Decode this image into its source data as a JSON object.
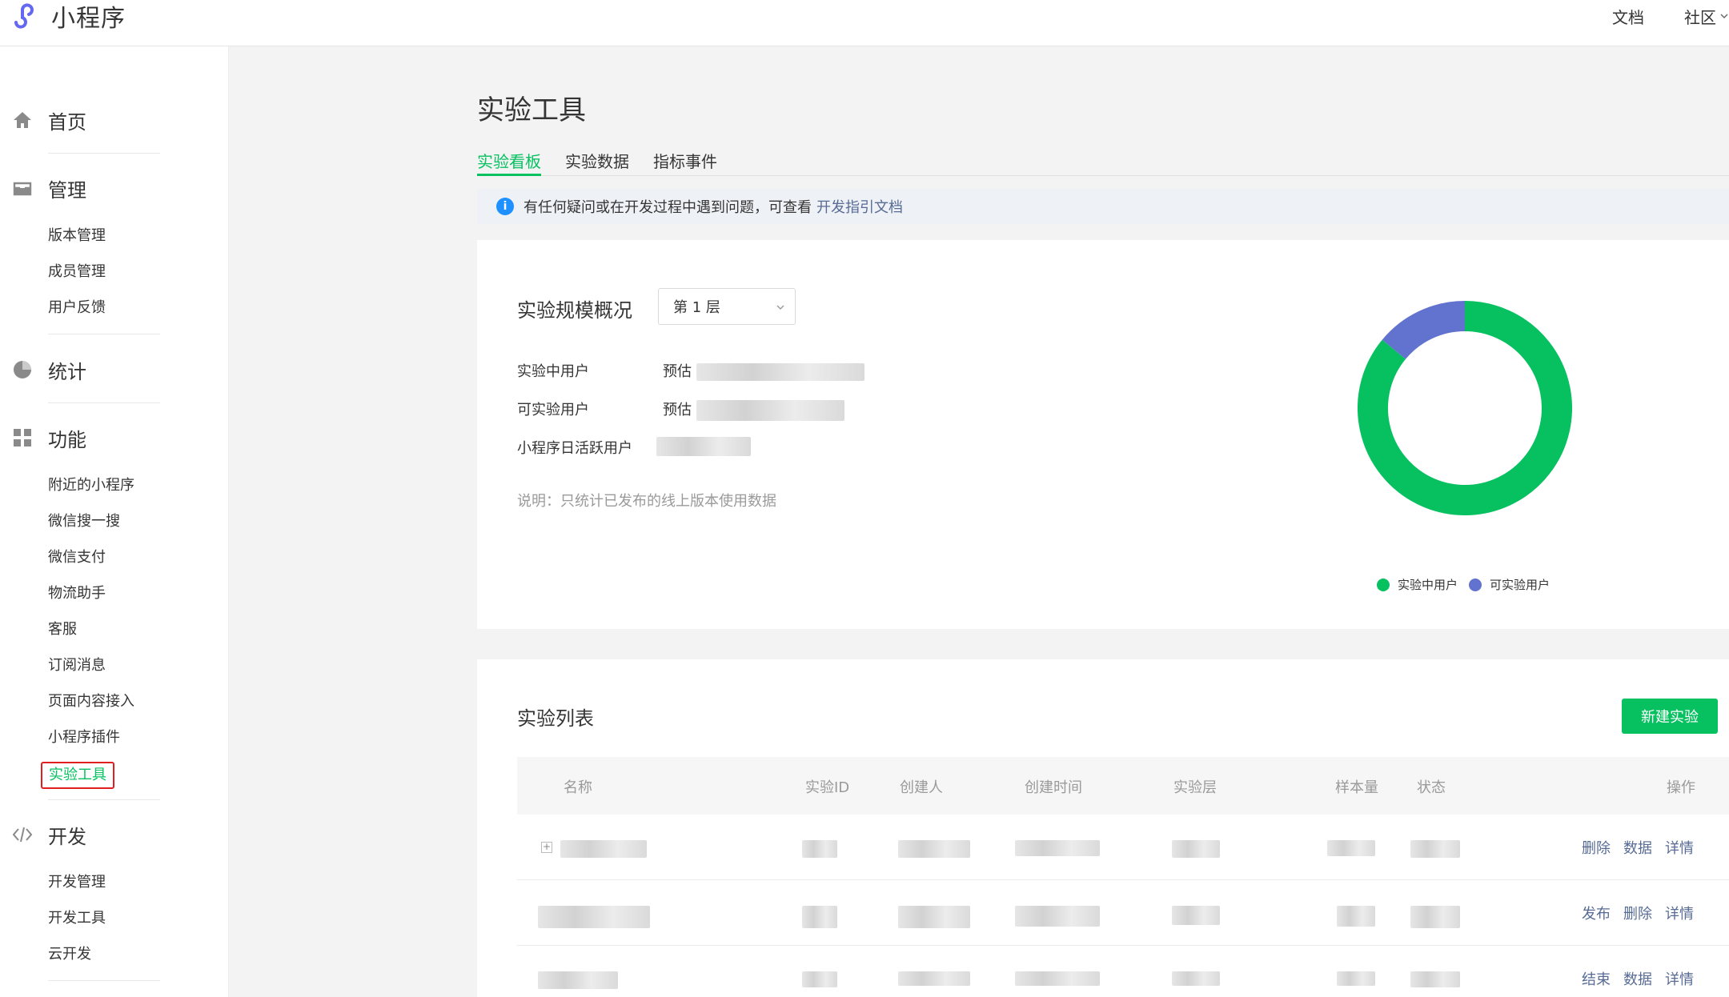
{
  "header": {
    "app_name": "小程序",
    "links": [
      {
        "label": "文档",
        "has_dropdown": false
      },
      {
        "label": "社区",
        "has_dropdown": true
      }
    ]
  },
  "sidebar": {
    "groups": [
      {
        "label": "首页",
        "icon": "home-icon",
        "items": []
      },
      {
        "label": "管理",
        "icon": "inbox-icon",
        "items": [
          "版本管理",
          "成员管理",
          "用户反馈"
        ]
      },
      {
        "label": "统计",
        "icon": "pie-chart-icon",
        "items": []
      },
      {
        "label": "功能",
        "icon": "grid-icon",
        "items": [
          "附近的小程序",
          "微信搜一搜",
          "微信支付",
          "物流助手",
          "客服",
          "订阅消息",
          "页面内容接入",
          "小程序插件",
          "实验工具"
        ]
      },
      {
        "label": "开发",
        "icon": "code-icon",
        "items": [
          "开发管理",
          "开发工具",
          "云开发"
        ]
      }
    ],
    "active_item": "实验工具"
  },
  "page": {
    "title": "实验工具",
    "tabs": [
      {
        "label": "实验看板",
        "active": true
      },
      {
        "label": "实验数据",
        "active": false
      },
      {
        "label": "指标事件",
        "active": false
      }
    ],
    "notice": {
      "text": "有任何疑问或在开发过程中遇到问题，可查看",
      "link": "开发指引文档"
    }
  },
  "overview": {
    "title": "实验规模概况",
    "layer_select": "第 1 层",
    "rows": [
      {
        "label": "实验中用户",
        "prefix": "预估"
      },
      {
        "label": "可实验用户",
        "prefix": "预估"
      },
      {
        "label": "小程序日活跃用户",
        "prefix": ""
      }
    ],
    "note": "说明：只统计已发布的线上版本使用数据"
  },
  "chart_data": {
    "type": "pie",
    "donut": true,
    "series": [
      {
        "name": "实验中用户",
        "value": 86,
        "color": "#07c160"
      },
      {
        "name": "可实验用户",
        "value": 14,
        "color": "#6272cf"
      }
    ],
    "legend_position": "bottom"
  },
  "list": {
    "title": "实验列表",
    "new_button": "新建实验",
    "columns": [
      "名称",
      "实验ID",
      "创建人",
      "创建时间",
      "实验层",
      "样本量",
      "状态",
      "操作"
    ],
    "rows": [
      {
        "actions": [
          "删除",
          "数据",
          "详情"
        ]
      },
      {
        "actions": [
          "发布",
          "删除",
          "详情"
        ]
      },
      {
        "actions": [
          "结束",
          "数据",
          "详情"
        ]
      }
    ]
  },
  "colors": {
    "accent": "#07c160",
    "link": "#576b95",
    "chart_blue": "#6272cf",
    "active_outline": "#e02020"
  }
}
